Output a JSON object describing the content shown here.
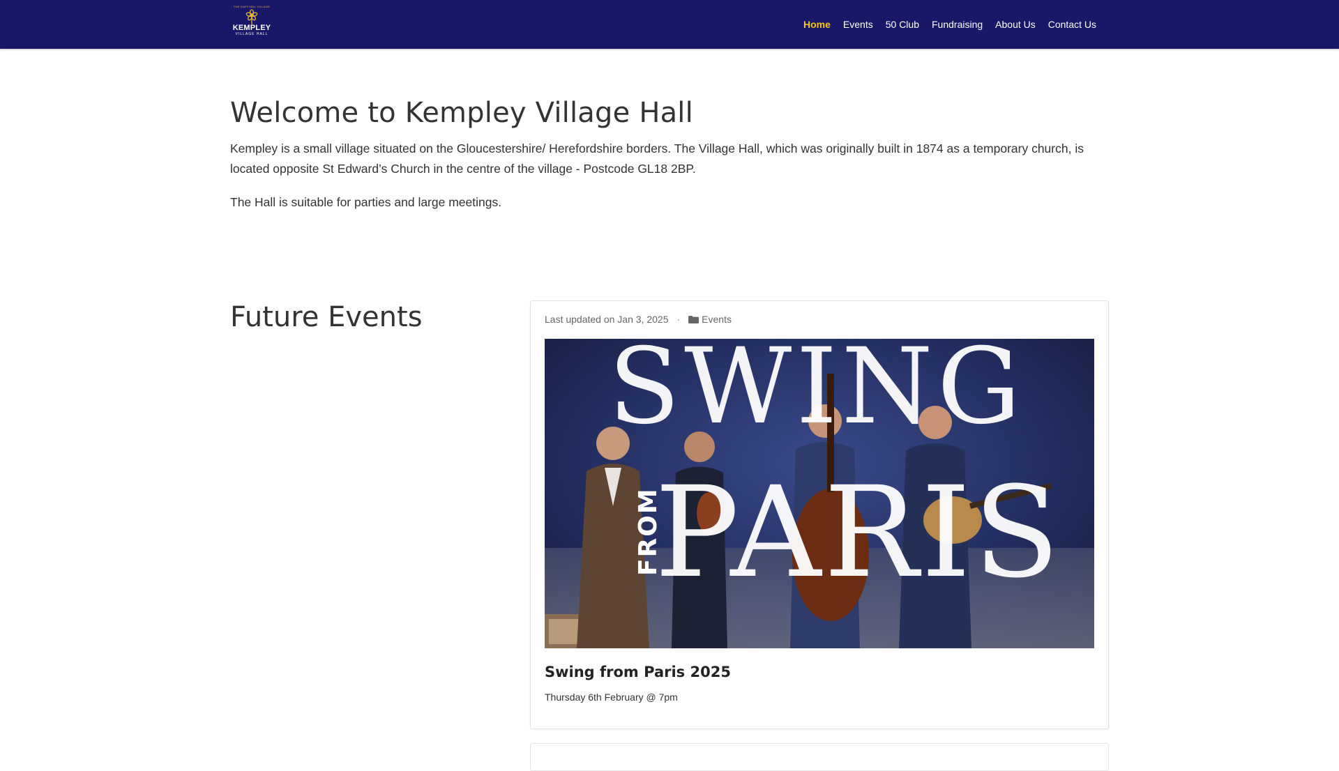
{
  "brand": {
    "logo_top": "THE DAFFODIL VILLAGE",
    "logo_main": "KEMPLEY",
    "logo_sub": "VILLAGE HALL",
    "colors": {
      "header_bg": "#191868",
      "active_nav": "#f5c518",
      "logo_gold": "#e3b53a"
    }
  },
  "nav": {
    "items": [
      {
        "label": "Home",
        "active": true
      },
      {
        "label": "Events"
      },
      {
        "label": "50 Club"
      },
      {
        "label": "Fundraising"
      },
      {
        "label": "About Us"
      },
      {
        "label": "Contact Us"
      }
    ]
  },
  "intro": {
    "title": "Welcome to Kempley Village Hall",
    "paragraph1": "Kempley is a small village situated on the Gloucestershire/ Herefordshire borders. The Village Hall, which was originally built in 1874 as a temporary church, is located opposite St Edward’s Church in the centre of the village - Postcode GL18 2BP.",
    "paragraph2": "The Hall is suitable for parties and large meetings."
  },
  "future_events": {
    "title": "Future Events",
    "posts": [
      {
        "meta_updated": "Last updated on Jan 3, 2025",
        "separator": "·",
        "category_icon": "folder-icon",
        "category": "Events",
        "image_text_top": "SWING",
        "image_text_side": "FROM",
        "image_text_main": "PARIS",
        "title": "Swing from Paris 2025",
        "date": "Thursday 6th February @ 7pm"
      }
    ]
  }
}
